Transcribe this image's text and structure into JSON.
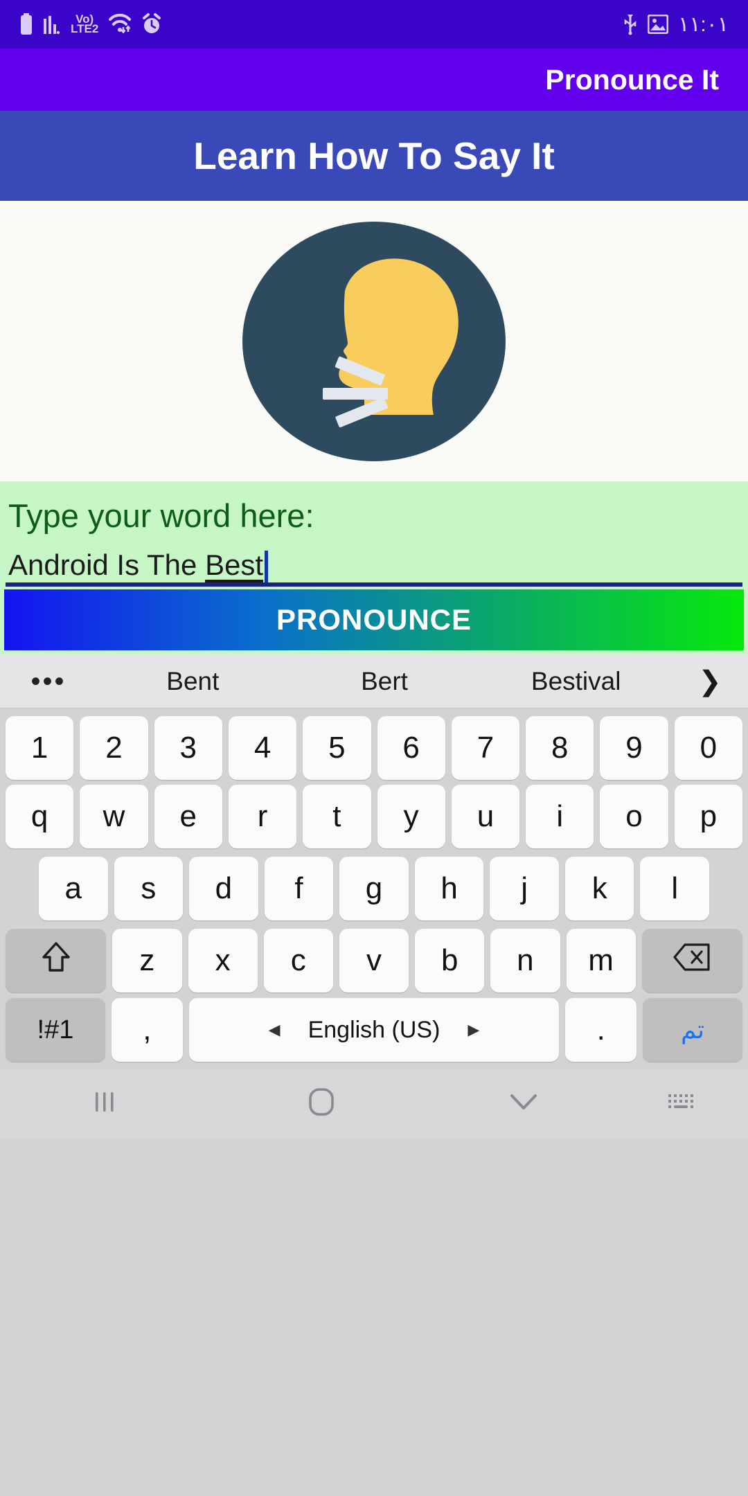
{
  "status_bar": {
    "time": "١١:٠١",
    "network_label_top": "Vo)",
    "network_label_bottom": "LTE2",
    "left_icons": [
      "battery-icon",
      "signal-bars-icon",
      "volte-icon",
      "wifi-icon",
      "alarm-icon"
    ],
    "right_icons": [
      "usb-icon",
      "screenshot-image-icon"
    ],
    "background": "#3A05C9"
  },
  "app_bar": {
    "title": "Pronounce It",
    "background": "#6200EE"
  },
  "banner": {
    "title": "Learn How To Say It",
    "background": "#3949B7"
  },
  "illustration": {
    "name": "speaking-head-illustration",
    "circle_color": "#2E4A5E",
    "head_color": "#F9CC5E",
    "line_color": "#E3E8EF",
    "background": "#FAFAF7"
  },
  "input_section": {
    "label": "Type your word here:",
    "value_plain": "Android Is The ",
    "value_composing": "Best",
    "placeholder": "Type your word here:",
    "background": "#C6F6C6",
    "label_color": "#0F5C18",
    "underline_color": "#1A237E",
    "caret_color": "#1134A6"
  },
  "pronounce_button": {
    "label": "PRONOUNCE",
    "gradient_start": "#1414F0",
    "gradient_end": "#06E80C"
  },
  "keyboard": {
    "suggestions": {
      "more_icon": "•••",
      "items": [
        "Bent",
        "Bert",
        "Bestival"
      ],
      "expand_icon": "❯"
    },
    "row_numbers": [
      "1",
      "2",
      "3",
      "4",
      "5",
      "6",
      "7",
      "8",
      "9",
      "0"
    ],
    "row_top": [
      "q",
      "w",
      "e",
      "r",
      "t",
      "y",
      "u",
      "i",
      "o",
      "p"
    ],
    "row_home": [
      "a",
      "s",
      "d",
      "f",
      "g",
      "h",
      "j",
      "k",
      "l"
    ],
    "row_bottom": [
      "z",
      "x",
      "c",
      "v",
      "b",
      "n",
      "m"
    ],
    "shift_key": "shift-icon",
    "backspace_key": "backspace-icon",
    "symbols_key": "!#1",
    "comma_key": ",",
    "space_key": "English (US)",
    "space_prev_icon": "◀",
    "space_next_icon": "▶",
    "period_key": ".",
    "done_key": "تم"
  },
  "nav_bar": {
    "recents": "recents-icon",
    "home": "home-icon",
    "hide_keyboard": "hide-keyboard-chevron-icon",
    "keyboard_switch": "keyboard-switch-icon"
  }
}
